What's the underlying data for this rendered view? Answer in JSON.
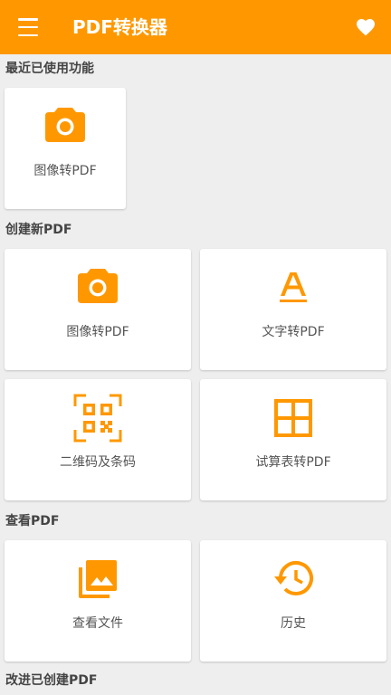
{
  "appbar": {
    "title": "PDF转换器",
    "menu_icon": "hamburger-menu-icon",
    "favorite_icon": "heart-icon"
  },
  "theme": {
    "accent": "#ff9800",
    "background": "#eeeeee",
    "card": "#ffffff"
  },
  "sections": {
    "recent": {
      "title": "最近已使用功能",
      "items": [
        {
          "label": "图像转PDF",
          "icon": "camera-icon"
        }
      ]
    },
    "create": {
      "title": "创建新PDF",
      "items": [
        {
          "label": "图像转PDF",
          "icon": "camera-icon"
        },
        {
          "label": "文字转PDF",
          "icon": "text-format-icon"
        },
        {
          "label": "二维码及条码",
          "icon": "qr-code-scanner-icon"
        },
        {
          "label": "试算表转PDF",
          "icon": "spreadsheet-grid-icon"
        }
      ]
    },
    "view": {
      "title": "查看PDF",
      "items": [
        {
          "label": "查看文件",
          "icon": "photo-library-icon"
        },
        {
          "label": "历史",
          "icon": "history-icon"
        }
      ]
    },
    "improve": {
      "title": "改进已创建PDF"
    }
  }
}
